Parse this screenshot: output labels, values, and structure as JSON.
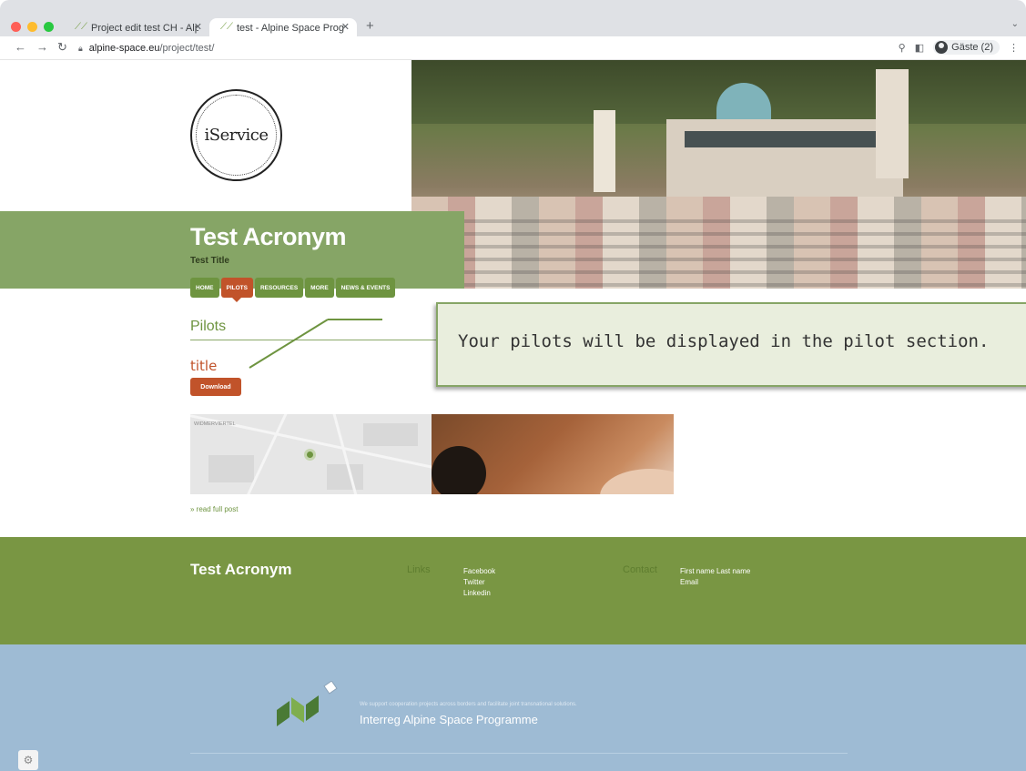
{
  "browser": {
    "tabs": [
      {
        "label": "Project edit test CH - Alpine Sp",
        "active": false
      },
      {
        "label": "test - Alpine Space Programme",
        "active": true
      }
    ],
    "new_tab": "+",
    "url_domain": "alpine-space.eu",
    "url_path": "/project/test/",
    "profile_label": "Gäste (2)",
    "icons": [
      "back-icon",
      "forward-icon",
      "reload-icon",
      "lock-icon",
      "zoom-icon",
      "sidebar-icon",
      "profile-icon",
      "menu-icon"
    ]
  },
  "site": {
    "logo_text": "iService",
    "project_title": "Test Acronym",
    "project_subtitle": "Test Title",
    "nav": [
      {
        "label": "HOME",
        "active": false
      },
      {
        "label": "PILOTS",
        "active": true
      },
      {
        "label": "RESOURCES",
        "active": false
      },
      {
        "label": "MORE",
        "active": false
      },
      {
        "label": "NEWS & EVENTS",
        "active": false
      }
    ],
    "section_title": "Pilots",
    "post": {
      "title": "title",
      "download_label": "Download",
      "map_label": "WIDMERVIERTEL",
      "read_more": "» read full post"
    }
  },
  "tooltip": {
    "text": "Your pilots will be displayed in the pilot section."
  },
  "footer": {
    "title": "Test Acronym",
    "links_heading": "Links",
    "links": [
      "Facebook",
      "Twitter",
      "Linkedin"
    ],
    "contact_heading": "Contact",
    "contact": [
      "First name Last name",
      "Email"
    ]
  },
  "programme": {
    "tagline": "We support cooperation projects across borders and facilitate joint transnational solutions.",
    "name": "Interreg Alpine Space Programme"
  },
  "colors": {
    "green": "#86a566",
    "nav_green": "#6e9440",
    "accent": "#c1532a",
    "footer_green": "#799643",
    "programme_blue": "#9ebbd4"
  }
}
